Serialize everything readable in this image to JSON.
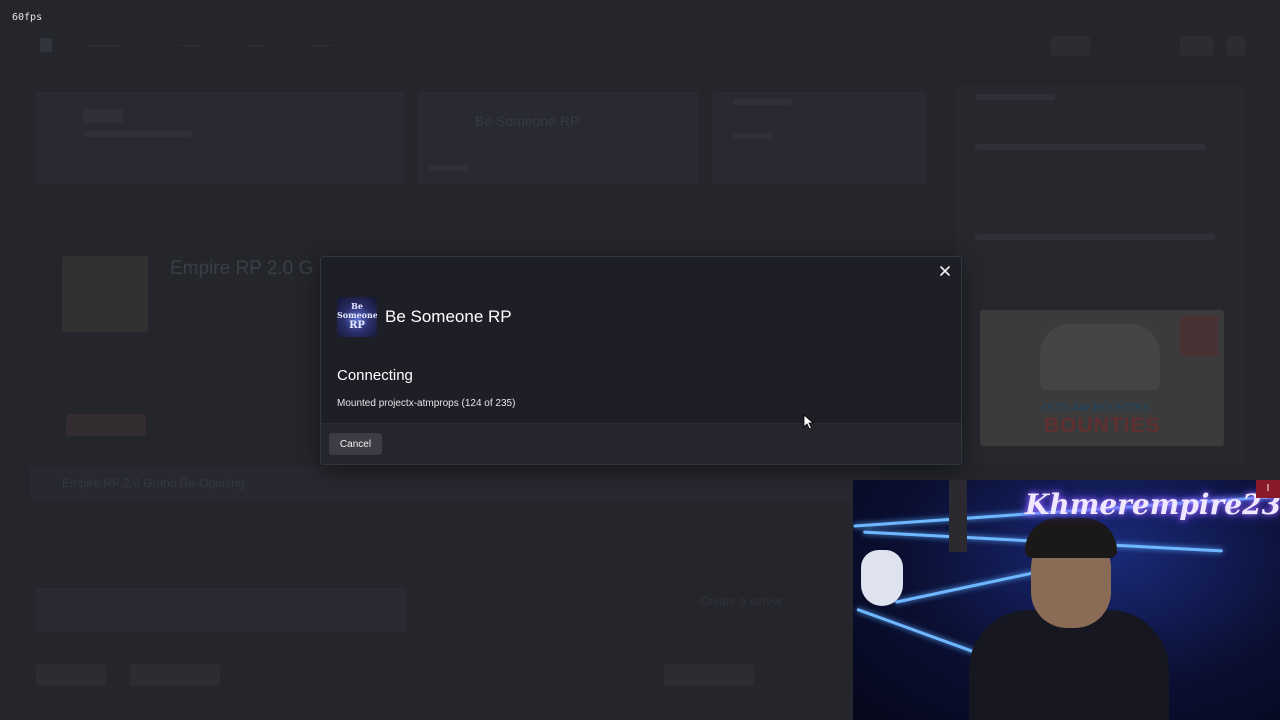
{
  "overlay": {
    "fps": "60fps"
  },
  "modal": {
    "server_name": "Be Someone RP",
    "server_icon_text": "Be Someone RP",
    "state": "Connecting",
    "detail": "Mounted projectx-atmprops (124 of 235)",
    "cancel_label": "Cancel",
    "progress": {
      "current": 124,
      "total": 235
    }
  },
  "background": {
    "featured_title": "Empire RP 2.0 G",
    "server_card_title": "Be Someone RP",
    "section_title": "Empire RP 2.0 Grand Re-Opening",
    "create_server": "Create a server",
    "promo_line1": "OUTLAW BOUNTIES",
    "promo_line2": "BOUNTIES"
  },
  "webcam": {
    "overlay_name": "Khmerempire23"
  },
  "colors": {
    "modal_bg": "#1e1f26",
    "footer_bg": "#25262d",
    "button_bg": "#3c3d44"
  }
}
